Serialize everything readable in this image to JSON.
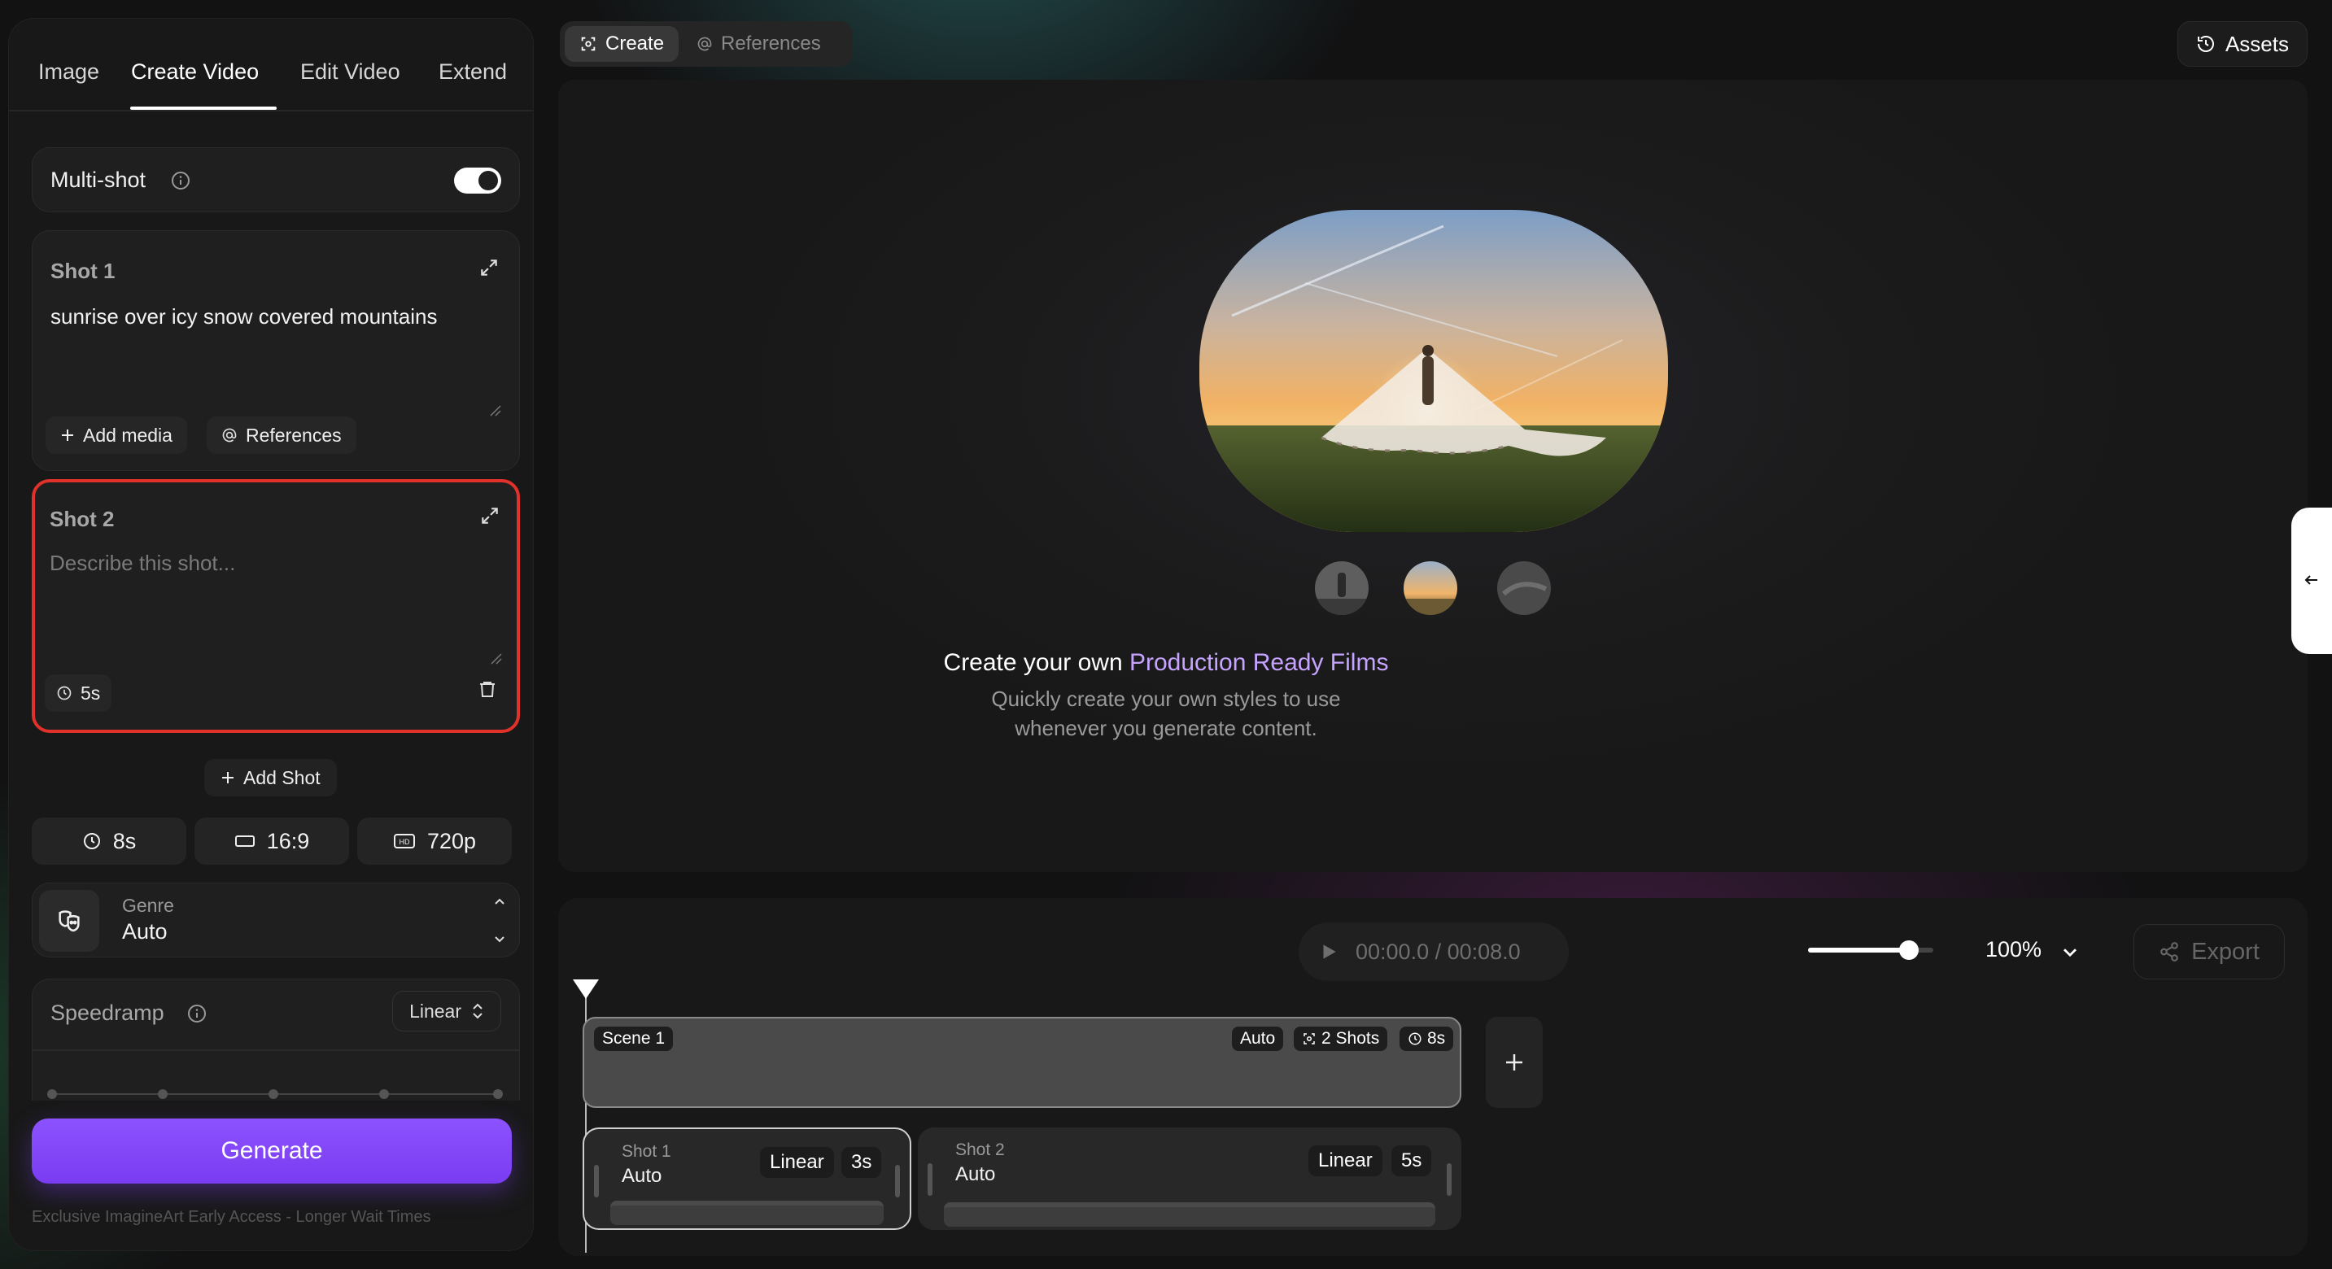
{
  "left_panel": {
    "tabs": [
      {
        "label": "Image"
      },
      {
        "label": "Create Video"
      },
      {
        "label": "Edit Video"
      },
      {
        "label": "Extend"
      }
    ],
    "active_tab": "Create Video",
    "multishot": {
      "label": "Multi-shot",
      "enabled": true
    },
    "shots": [
      {
        "title": "Shot 1",
        "prompt": "sunrise over icy snow covered mountains",
        "add_media_label": "Add media",
        "references_label": "References"
      },
      {
        "title": "Shot 2",
        "placeholder": "Describe this shot...",
        "duration": "5s"
      }
    ],
    "add_shot_label": "Add Shot",
    "options": {
      "duration": "8s",
      "aspect": "16:9",
      "resolution": "720p"
    },
    "genre": {
      "label": "Genre",
      "value": "Auto"
    },
    "speedramp": {
      "label": "Speedramp",
      "value": "Linear"
    },
    "generate_label": "Generate",
    "footnote": "Exclusive ImagineArt Early Access - Longer Wait Times"
  },
  "toolbar": {
    "create_label": "Create",
    "references_label": "References",
    "assets_label": "Assets"
  },
  "preview": {
    "headline_prefix": "Create your own ",
    "headline_accent": "Production Ready Films",
    "subline_1": "Quickly create your own styles to use",
    "subline_2": "whenever you generate content."
  },
  "timeline": {
    "time": "00:00.0 / 00:08.0",
    "zoom": "100%",
    "zoom_fraction": 0.8,
    "export_label": "Export",
    "scene": {
      "label": "Scene 1",
      "mode": "Auto",
      "shots": "2 Shots",
      "duration": "8s"
    },
    "clips": [
      {
        "title": "Shot 1",
        "value": "Auto",
        "ramp": "Linear",
        "duration": "3s"
      },
      {
        "title": "Shot 2",
        "value": "Auto",
        "ramp": "Linear",
        "duration": "5s"
      }
    ]
  },
  "colors": {
    "accent": "#8c52ff",
    "accent_text": "#c6a3ff",
    "highlight": "#e0312b"
  },
  "icons": [
    "info-icon",
    "expand-icon",
    "plus-icon",
    "at-icon",
    "clock-icon",
    "trash-icon",
    "aspect-icon",
    "hd-icon",
    "genre-icon",
    "chevron-up-icon",
    "chevron-down-icon",
    "updown-icon",
    "history-icon",
    "play-icon",
    "share-icon",
    "arrow-left-icon",
    "playhead-icon",
    "shots-icon"
  ]
}
